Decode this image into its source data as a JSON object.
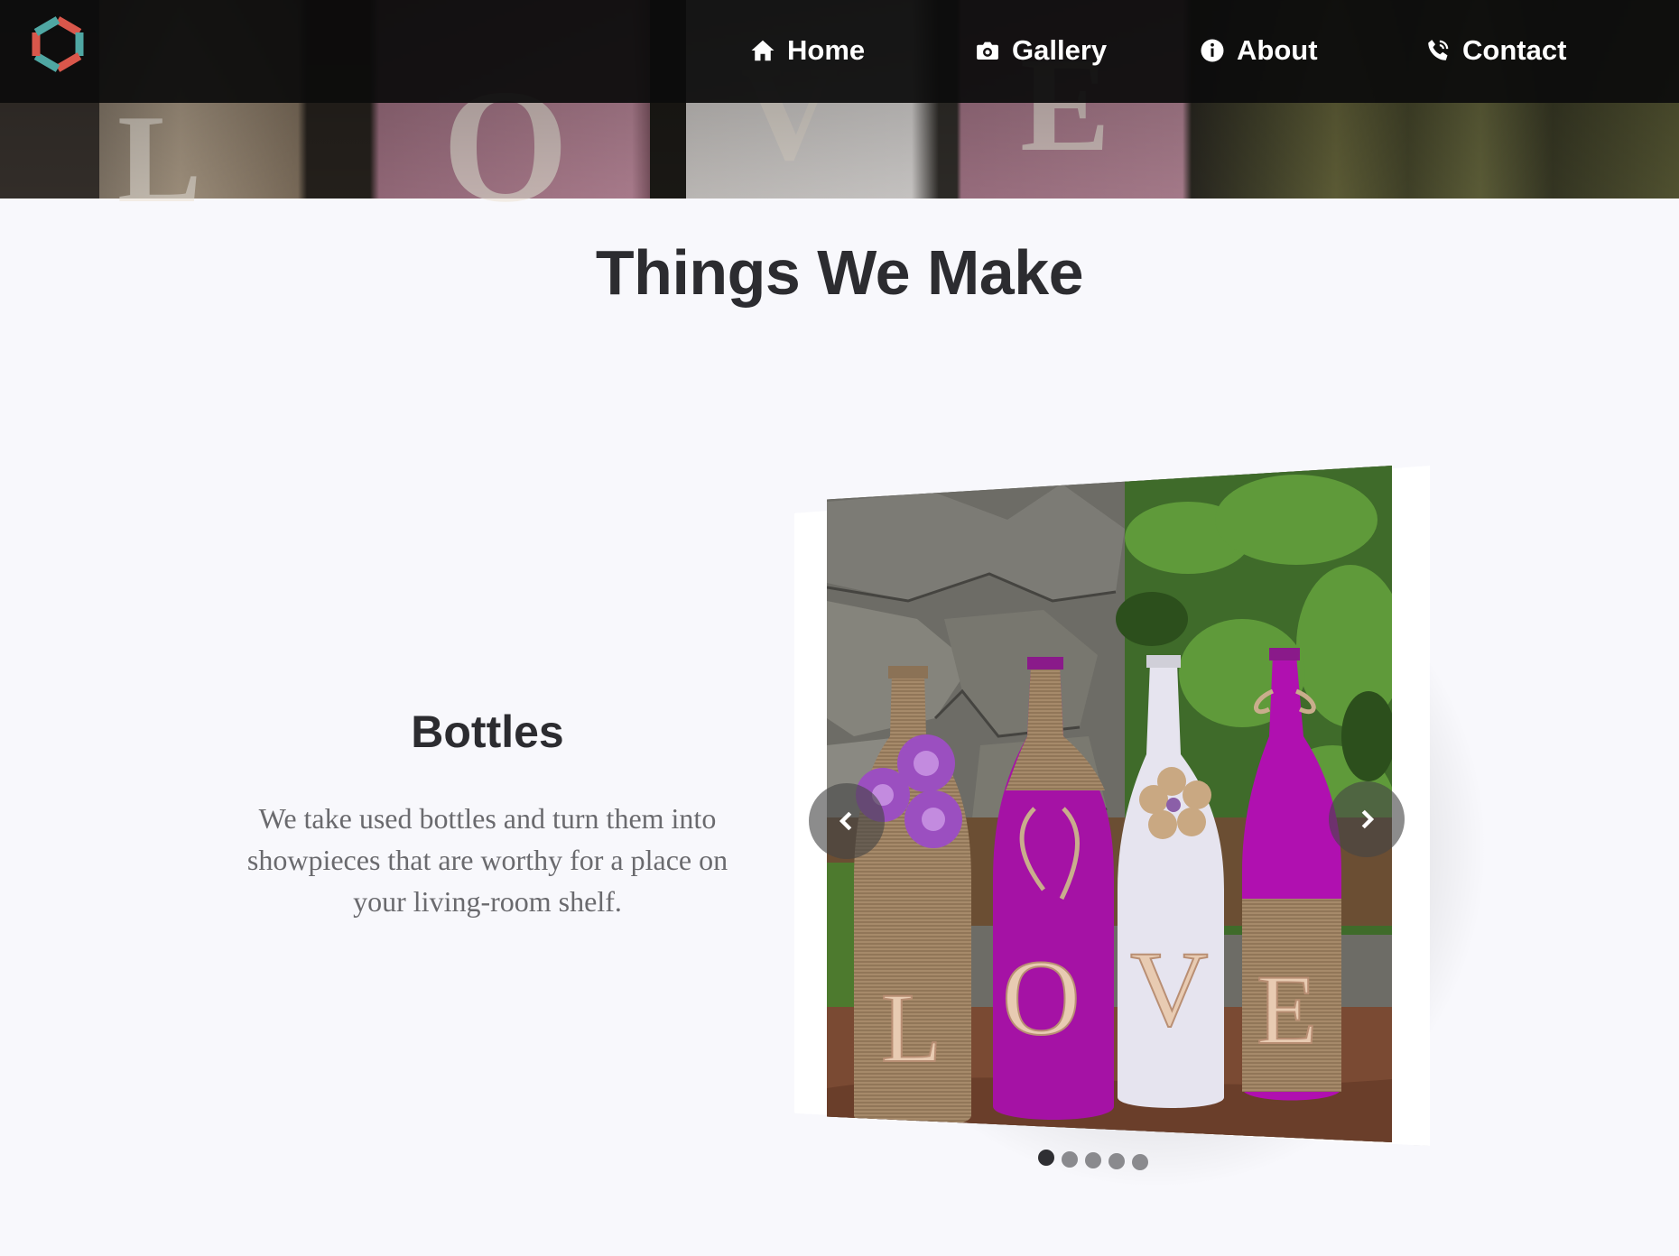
{
  "nav": {
    "items": [
      {
        "label": "Home",
        "icon": "home-icon"
      },
      {
        "label": "Gallery",
        "icon": "camera-icon"
      },
      {
        "label": "About",
        "icon": "info-icon"
      },
      {
        "label": "Contact",
        "icon": "phone-icon"
      }
    ]
  },
  "hero": {
    "letters": [
      "L",
      "O",
      "V",
      "E"
    ]
  },
  "section": {
    "title": "Things We Make"
  },
  "product": {
    "name": "Bottles",
    "description": "We take used bottles and turn them into showpieces that are worthy for a place on your living-room shelf."
  },
  "carousel": {
    "slide_count": 5,
    "active_index": 0,
    "bottle_letters": [
      "L",
      "O",
      "V",
      "E"
    ]
  },
  "colors": {
    "navbar": "#0c0c0c",
    "page_background": "#f8f8fc",
    "heading": "#2c2c30",
    "body_text": "#6a6a6e",
    "logo_red": "#d9574b",
    "logo_teal": "#4fa7a3",
    "bottle_purple": "#a512a5"
  }
}
